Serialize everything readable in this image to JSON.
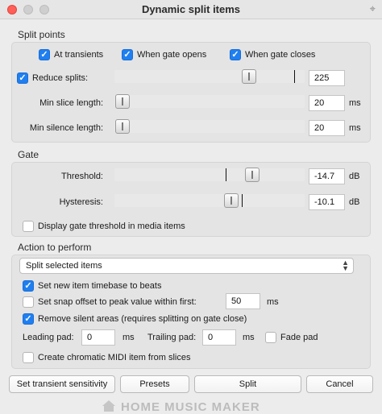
{
  "window": {
    "title": "Dynamic split items",
    "pin_icon": "pin-icon"
  },
  "split_points": {
    "title": "Split points",
    "at_transients": {
      "label": "At transients",
      "checked": true
    },
    "when_gate_opens": {
      "label": "When gate opens",
      "checked": true
    },
    "when_gate_closes": {
      "label": "When gate closes",
      "checked": true
    },
    "reduce_splits": {
      "label": "Reduce splits:",
      "checked": true,
      "value": "225"
    },
    "min_slice_length": {
      "label": "Min slice length:",
      "value": "20",
      "unit": "ms"
    },
    "min_silence_length": {
      "label": "Min silence length:",
      "value": "20",
      "unit": "ms"
    }
  },
  "gate": {
    "title": "Gate",
    "threshold": {
      "label": "Threshold:",
      "value": "-14.7",
      "unit": "dB"
    },
    "hysteresis": {
      "label": "Hysteresis:",
      "value": "-10.1",
      "unit": "dB"
    },
    "display_threshold": {
      "label": "Display gate threshold in media items",
      "checked": false
    }
  },
  "action": {
    "title": "Action to perform",
    "selected_action": "Split selected items",
    "set_timebase": {
      "label": "Set new item timebase to beats",
      "checked": true
    },
    "snap_offset": {
      "label": "Set snap offset to peak value within first:",
      "checked": false,
      "value": "50",
      "unit": "ms"
    },
    "remove_silent": {
      "label": "Remove silent areas (requires splitting on gate close)",
      "checked": true
    },
    "leading_pad": {
      "label": "Leading pad:",
      "value": "0",
      "unit": "ms"
    },
    "trailing_pad": {
      "label": "Trailing pad:",
      "value": "0",
      "unit": "ms"
    },
    "fade_pad": {
      "label": "Fade pad",
      "checked": false
    },
    "chromatic_midi": {
      "label": "Create chromatic MIDI item from slices",
      "checked": false
    }
  },
  "buttons": {
    "transient_sensitivity": "Set transient sensitivity",
    "presets": "Presets",
    "split": "Split",
    "cancel": "Cancel"
  },
  "watermark": "HOME MUSIC MAKER",
  "colors": {
    "accent": "#1f7ff0",
    "close": "#ff5f57"
  }
}
